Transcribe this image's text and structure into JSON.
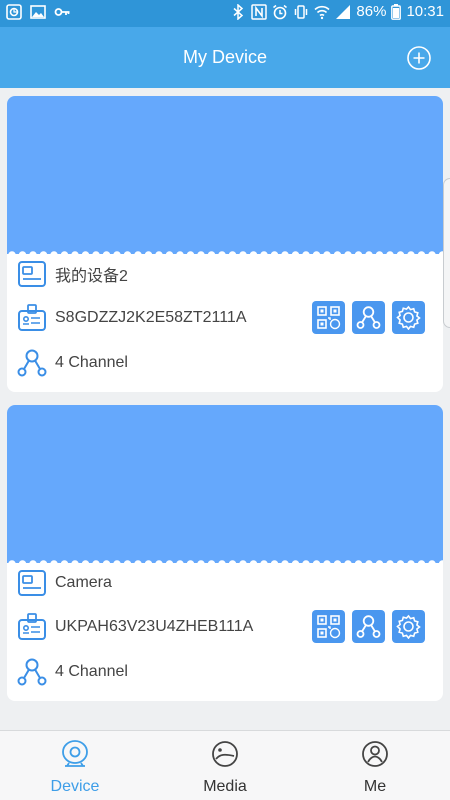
{
  "status_bar": {
    "battery": "86%",
    "time": "10:31"
  },
  "header": {
    "title": "My Device"
  },
  "devices": [
    {
      "name": "我的设备2",
      "serial": "S8GDZZJ2K2E58ZT2111A",
      "channels": "4 Channel"
    },
    {
      "name": "Camera",
      "serial": "UKPAH63V23U4ZHEB111A",
      "channels": "4 Channel"
    }
  ],
  "nav": {
    "device": "Device",
    "media": "Media",
    "me": "Me",
    "active": "Device"
  },
  "colors": {
    "app_bar": "#48a8ea",
    "status_bar": "#2f95d8",
    "thumbnail": "#65a8fc",
    "action_button": "#4a97ef",
    "icon_blue": "#3a8ee6",
    "active_tab": "#3e9ee8"
  },
  "icons": {
    "header_action": "add-circle-icon",
    "card_name": "device-card-icon",
    "card_serial": "id-badge-icon",
    "card_channel": "share-nodes-icon",
    "action_1": "qr-code-icon",
    "action_2": "share-nodes-icon",
    "action_3": "settings-gear-icon"
  }
}
